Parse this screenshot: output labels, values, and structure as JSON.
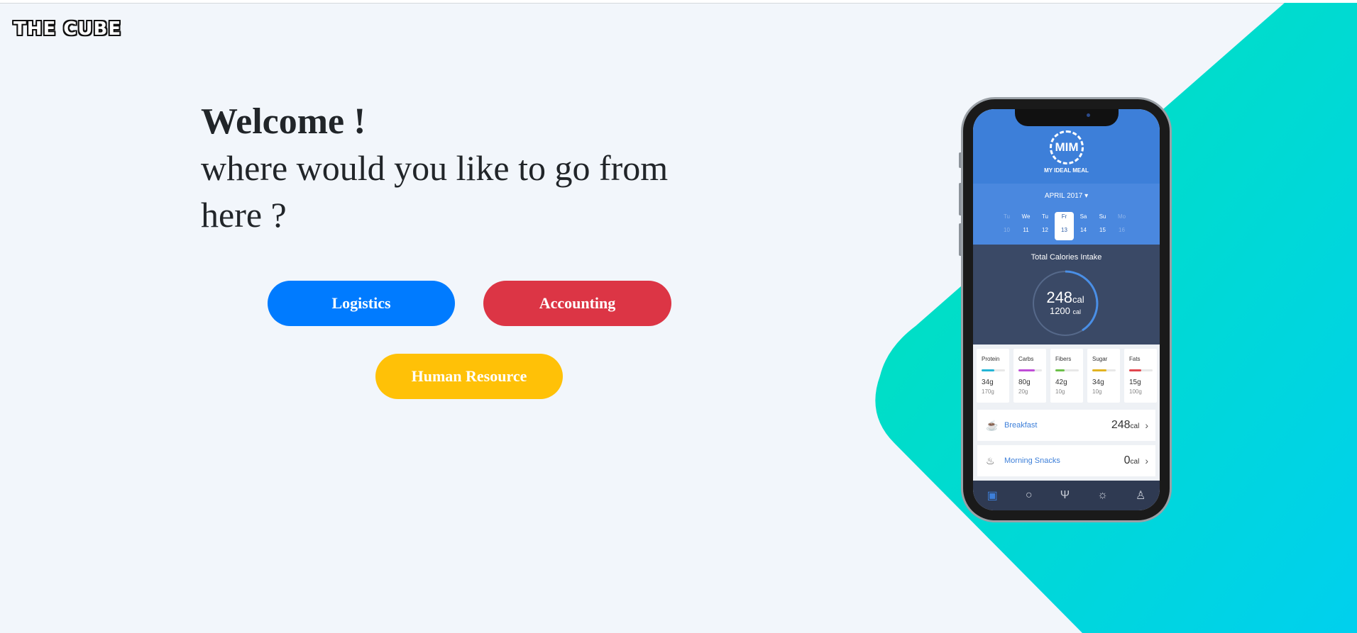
{
  "brand": {
    "logo_text": "THE CUBE"
  },
  "welcome": {
    "title": "Welcome !",
    "subtitle": "where would you like to go from here ?"
  },
  "buttons": {
    "logistics": "Logistics",
    "accounting": "Accounting",
    "human_resource": "Human Resource"
  },
  "colors": {
    "logistics": "#007bff",
    "accounting": "#dc3545",
    "human_resource": "#ffc107",
    "shape_gradient": [
      "#00e0b8",
      "#00d2ea"
    ]
  },
  "phone_app": {
    "logo": "MIM",
    "app_name": "MY IDEAL MEAL",
    "month": "APRIL 2017 ▾",
    "days": [
      {
        "name": "Tu",
        "date": "10"
      },
      {
        "name": "We",
        "date": "11"
      },
      {
        "name": "Tu",
        "date": "12"
      },
      {
        "name": "Fr",
        "date": "13"
      },
      {
        "name": "Sa",
        "date": "14"
      },
      {
        "name": "Su",
        "date": "15"
      },
      {
        "name": "Mo",
        "date": "16"
      }
    ],
    "selected_day": "Fr 13",
    "totals_title": "Total Calories Intake",
    "calories": "248",
    "calories_max": "1200",
    "unit": "cal",
    "nutrients": [
      {
        "name": "Protein",
        "value": "34g",
        "max": "170g",
        "color": "#24b5d6"
      },
      {
        "name": "Carbs",
        "value": "80g",
        "max": "20g",
        "color": "#c04dd8"
      },
      {
        "name": "Fibers",
        "value": "42g",
        "max": "10g",
        "color": "#6cc04a"
      },
      {
        "name": "Sugar",
        "value": "34g",
        "max": "10g",
        "color": "#e2b321"
      },
      {
        "name": "Fats",
        "value": "15g",
        "max": "100g",
        "color": "#e2474f"
      }
    ],
    "meals": [
      {
        "name": "Breakfast",
        "value": "248",
        "unit": "cal"
      },
      {
        "name": "Morning Snacks",
        "value": "0",
        "unit": "cal"
      }
    ],
    "tabs": [
      "diary-icon",
      "search-icon",
      "food-icon",
      "idea-icon",
      "profile-icon"
    ]
  }
}
